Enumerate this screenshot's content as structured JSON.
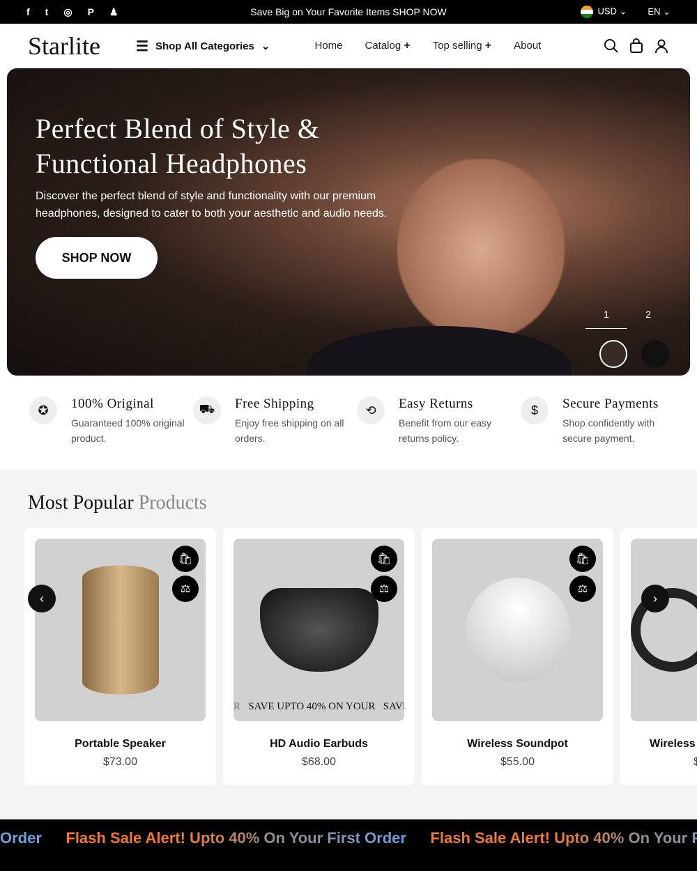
{
  "topbar": {
    "social": [
      "f",
      "t",
      "◎",
      "P",
      "♟"
    ],
    "social_icons": [
      "facebook-icon",
      "twitter-icon",
      "instagram-icon",
      "pinterest-icon",
      "snapchat-icon"
    ],
    "promo": "Save Big on Your Favorite Items SHOP NOW",
    "currency": "USD",
    "language": "EN"
  },
  "header": {
    "logo": "Starlite",
    "categories": "Shop All Categories",
    "nav": [
      {
        "label": "Home"
      },
      {
        "label": "Catalog",
        "plus": "+"
      },
      {
        "label": "Top selling",
        "plus": "+"
      },
      {
        "label": "About"
      }
    ]
  },
  "hero": {
    "title_line1": "Perfect Blend of Style &",
    "title_line2": "Functional Headphones",
    "text": "Discover the perfect blend of style and functionality with our premium headphones, designed to cater to both your aesthetic and audio needs.",
    "button": "SHOP NOW",
    "slides": [
      "1",
      "2"
    ],
    "active_slide": 1
  },
  "features": [
    {
      "title": "100% Original",
      "text": "Guaranteed 100% original product.",
      "icon": "badge-icon"
    },
    {
      "title": "Free Shipping",
      "text": "Enjoy free shipping on all orders.",
      "icon": "truck-icon"
    },
    {
      "title": "Easy Returns",
      "text": "Benefit from our easy returns policy.",
      "icon": "box-return-icon"
    },
    {
      "title": "Secure Payments",
      "text": "Shop confidently with secure payment.",
      "icon": "secure-payment-icon"
    }
  ],
  "popular": {
    "title": "Most Popular",
    "title_accent": "Products",
    "marquee_a": "SAVE UPTO 40% ON YOUR",
    "marquee_b": "SAVE",
    "marquee_pre": "R",
    "products": [
      {
        "name": "Portable Speaker",
        "price": "$73.00"
      },
      {
        "name": "HD Audio Earbuds",
        "price": "$68.00"
      },
      {
        "name": "Wireless Soundpot",
        "price": "$55.00"
      },
      {
        "name": "Wireless Headphones",
        "price": "$"
      }
    ]
  },
  "flash": {
    "text": "Flash Sale Alert! Upto 40% On Your First Order",
    "partial": "Order"
  },
  "colors": {
    "flash_orange": "#f47a2a",
    "flash_blue": "#6aa0e0",
    "accent": "#000000"
  }
}
